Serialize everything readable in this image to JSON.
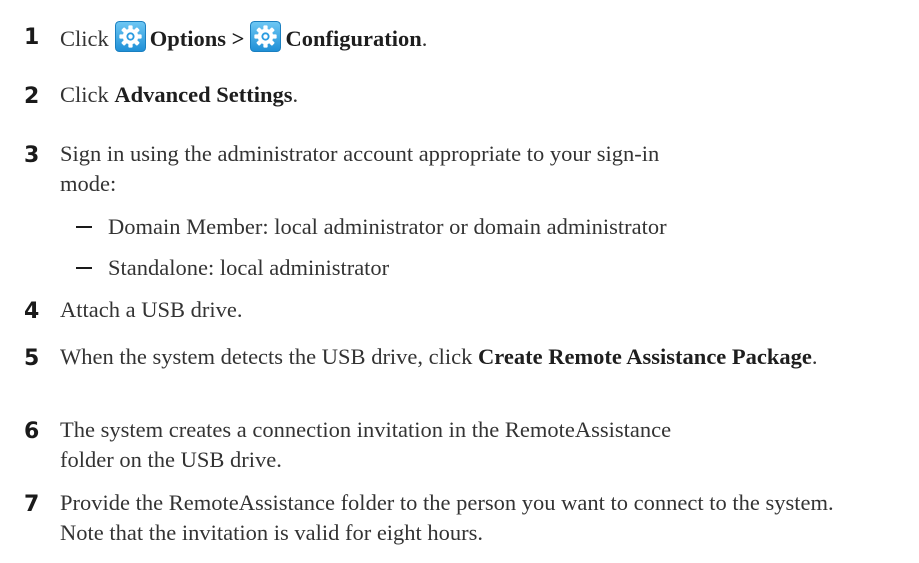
{
  "steps": [
    {
      "number": "1",
      "prefix": "Click",
      "item1": "Options >",
      "item2": "Configuration",
      "suffix": ".",
      "icons": [
        "gear-icon",
        "gear-icon"
      ]
    },
    {
      "number": "2",
      "prefix": "Click ",
      "bold": "Advanced Settings",
      "suffix": "."
    },
    {
      "number": "3",
      "text": "Sign in using the administrator account appropriate to your sign-in mode:",
      "subitems": [
        "Domain Member: local administrator or domain administrator",
        "Standalone: local administrator"
      ]
    },
    {
      "number": "4",
      "text": "Attach a USB drive."
    },
    {
      "number": "5",
      "prefix": "When the system detects the USB drive, click ",
      "bold": "Create Remote Assistance Package",
      "suffix": "."
    },
    {
      "number": "6",
      "text": "The system creates a connection invitation in the RemoteAssistance folder on the USB drive."
    },
    {
      "number": "7",
      "text": "Provide the RemoteAssistance folder to the person you want to connect to the system. Note that the invitation is valid for eight hours."
    }
  ],
  "colors": {
    "icon_gradient_top": "#6ec8f4",
    "icon_gradient_bottom": "#1e8fd6"
  }
}
